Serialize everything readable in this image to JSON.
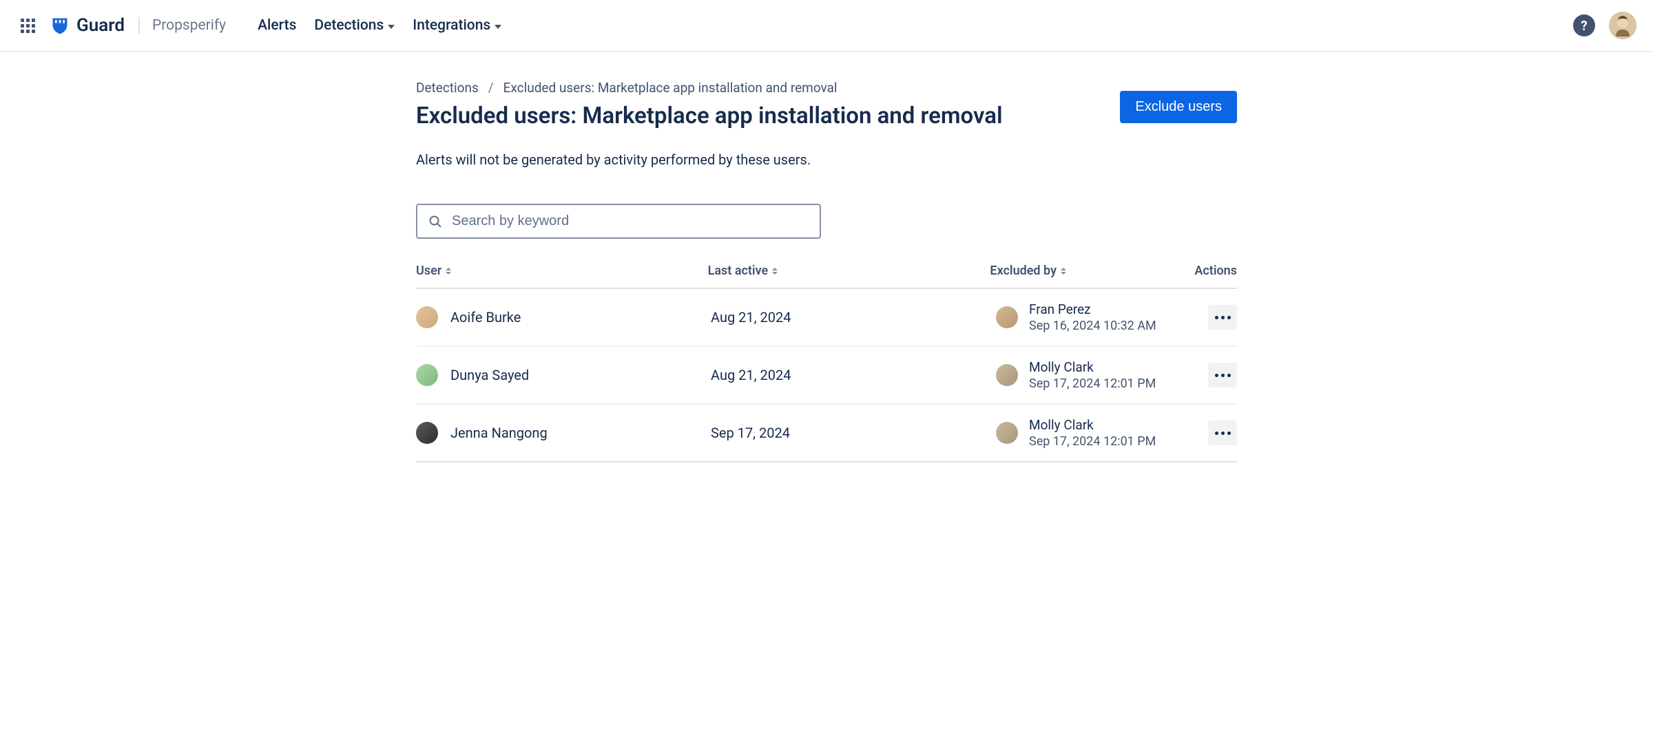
{
  "nav": {
    "product_name": "Guard",
    "org_name": "Propsperify",
    "items": [
      {
        "label": "Alerts",
        "has_dropdown": false
      },
      {
        "label": "Detections",
        "has_dropdown": true
      },
      {
        "label": "Integrations",
        "has_dropdown": true
      }
    ]
  },
  "breadcrumb": {
    "parent": "Detections",
    "current": "Excluded users: Marketplace app installation and removal"
  },
  "page": {
    "title": "Excluded users: Marketplace app installation and removal",
    "description": "Alerts will not be generated by activity performed by these users.",
    "primary_action": "Exclude users"
  },
  "search": {
    "placeholder": "Search by keyword",
    "value": ""
  },
  "table": {
    "columns": {
      "user": "User",
      "last_active": "Last active",
      "excluded_by": "Excluded by",
      "actions": "Actions"
    },
    "rows": [
      {
        "user_name": "Aoife Burke",
        "last_active": "Aug 21, 2024",
        "excluded_by_name": "Fran Perez",
        "excluded_at": "Sep 16, 2024 10:32 AM"
      },
      {
        "user_name": "Dunya Sayed",
        "last_active": "Aug 21, 2024",
        "excluded_by_name": "Molly Clark",
        "excluded_at": "Sep 17, 2024 12:01 PM"
      },
      {
        "user_name": "Jenna Nangong",
        "last_active": "Sep 17, 2024",
        "excluded_by_name": "Molly Clark",
        "excluded_at": "Sep 17, 2024 12:01 PM"
      }
    ]
  }
}
